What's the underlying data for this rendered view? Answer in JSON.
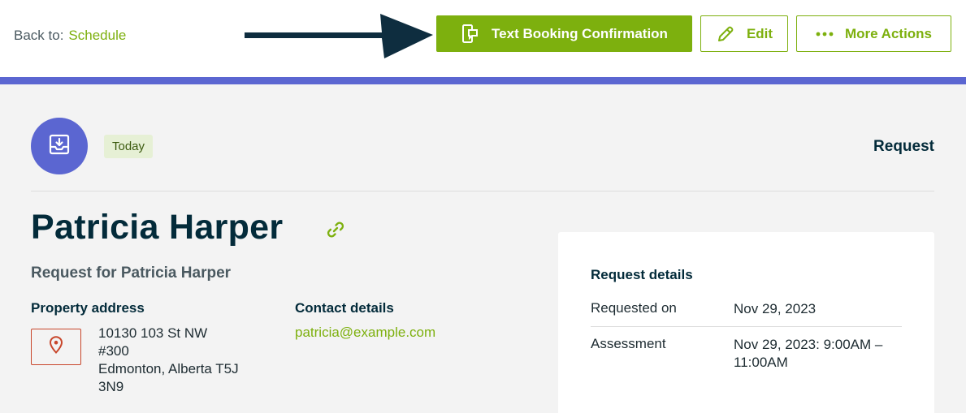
{
  "header": {
    "back_prefix": "Back to:",
    "back_link": "Schedule",
    "primary_action": "Text Booking Confirmation",
    "edit_label": "Edit",
    "more_label": "More Actions"
  },
  "colors": {
    "accent": "#5b66d1",
    "brand_green": "#7db00e",
    "navy": "#032b3a",
    "pin_red": "#c8462b"
  },
  "icons": {
    "avatar": "inbox-download-icon",
    "primary_action": "text-message-icon",
    "edit": "pencil-icon",
    "more": "ellipsis-icon",
    "name_link": "link-icon",
    "address": "map-pin-icon"
  },
  "request": {
    "badge": "Today",
    "type": "Request",
    "client_name": "Patricia Harper",
    "subtitle": "Request for Patricia Harper"
  },
  "property": {
    "heading": "Property address",
    "line1": "10130 103 St NW",
    "line2": "#300",
    "line3": "Edmonton, Alberta T5J",
    "line4": "3N9"
  },
  "contact": {
    "heading": "Contact details",
    "email": "patricia@example.com"
  },
  "details": {
    "heading": "Request details",
    "rows": [
      {
        "label": "Requested on",
        "value": "Nov 29, 2023"
      },
      {
        "label": "Assessment",
        "value": "Nov 29, 2023: 9:00AM – 11:00AM"
      }
    ]
  }
}
